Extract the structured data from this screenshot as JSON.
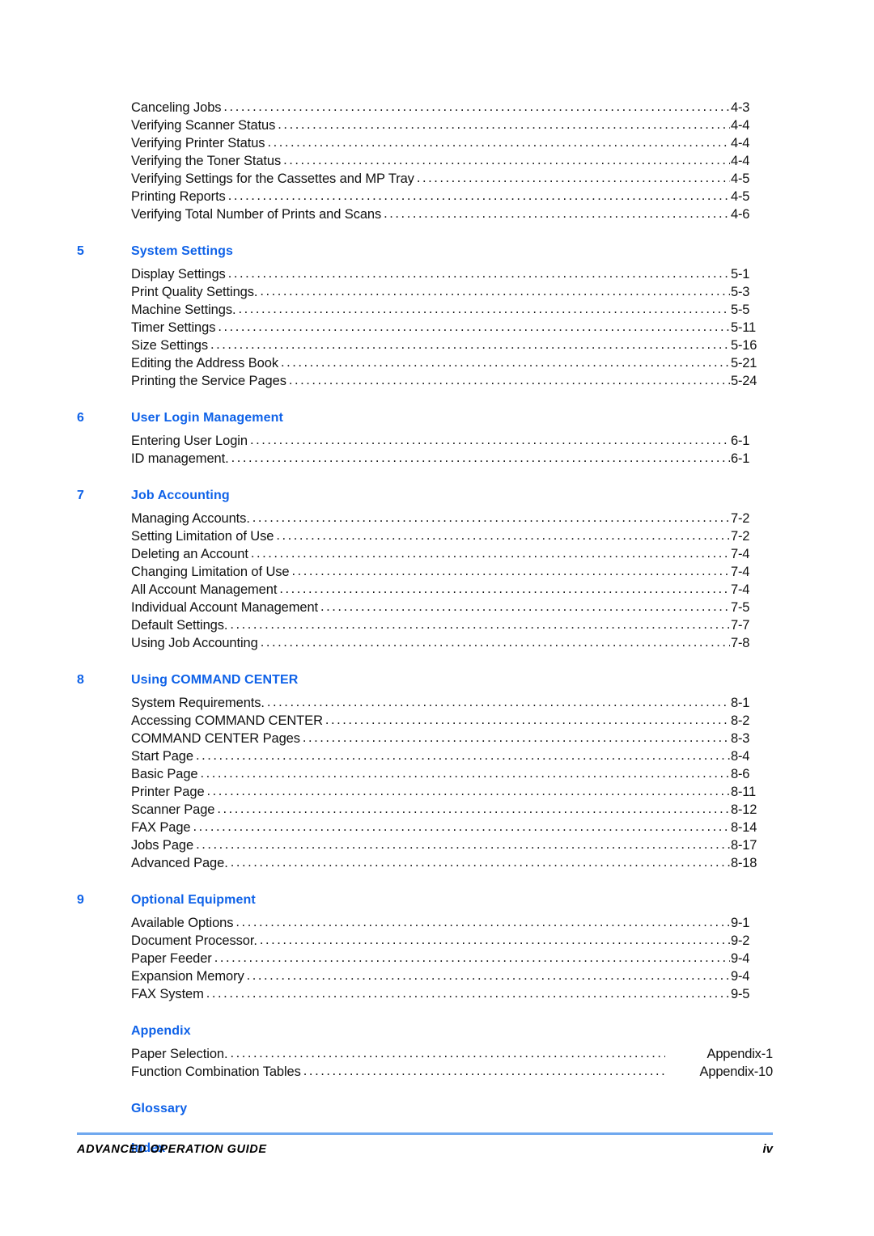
{
  "document": {
    "footer_title": "ADVANCED OPERATION GUIDE",
    "footer_page": "iv",
    "rule_color": "#6fa8ef",
    "heading_color": "#0f62e8",
    "leader_char": "."
  },
  "toc": {
    "blocks": [
      {
        "id": "continued-chapter-4",
        "number": "",
        "title": "",
        "has_heading": false,
        "spaced": false,
        "entries": [
          {
            "label": "Canceling Jobs",
            "page": "4-3",
            "wide": false
          },
          {
            "label": "Verifying Scanner Status",
            "page": "4-4",
            "wide": false
          },
          {
            "label": "Verifying Printer Status",
            "page": "4-4",
            "wide": false
          },
          {
            "label": "Verifying the Toner Status",
            "page": "4-4",
            "wide": false
          },
          {
            "label": "Verifying Settings for the Cassettes and MP Tray",
            "page": "4-5",
            "wide": false
          },
          {
            "label": "Printing Reports",
            "page": "4-5",
            "wide": false
          },
          {
            "label": "Verifying Total Number of Prints and Scans",
            "page": "4-6",
            "wide": false
          }
        ]
      },
      {
        "id": "chapter-5",
        "number": "5",
        "title": "System Settings",
        "has_heading": true,
        "spaced": true,
        "entries": [
          {
            "label": "Display Settings",
            "page": "5-1",
            "wide": false
          },
          {
            "label": "Print Quality Settings.",
            "page": "5-3",
            "wide": false
          },
          {
            "label": "Machine Settings.",
            "page": "5-5",
            "wide": false
          },
          {
            "label": "Timer Settings",
            "page": "5-11",
            "wide": false
          },
          {
            "label": "Size Settings",
            "page": "5-16",
            "wide": false
          },
          {
            "label": "Editing the Address Book",
            "page": "5-21",
            "wide": false
          },
          {
            "label": "Printing the Service Pages",
            "page": "5-24",
            "wide": false
          }
        ]
      },
      {
        "id": "chapter-6",
        "number": "6",
        "title": "User Login Management",
        "has_heading": true,
        "spaced": true,
        "entries": [
          {
            "label": "Entering User Login",
            "page": "6-1",
            "wide": false
          },
          {
            "label": "ID management.",
            "page": "6-1",
            "wide": false
          }
        ]
      },
      {
        "id": "chapter-7",
        "number": "7",
        "title": "Job Accounting",
        "has_heading": true,
        "spaced": true,
        "entries": [
          {
            "label": "Managing Accounts.",
            "page": "7-2",
            "wide": false
          },
          {
            "label": "Setting Limitation of Use",
            "page": "7-2",
            "wide": false
          },
          {
            "label": "Deleting an Account",
            "page": "7-4",
            "wide": false
          },
          {
            "label": "Changing Limitation of Use",
            "page": "7-4",
            "wide": false
          },
          {
            "label": "All Account Management",
            "page": "7-4",
            "wide": false
          },
          {
            "label": "Individual Account Management",
            "page": "7-5",
            "wide": false
          },
          {
            "label": "Default Settings.",
            "page": "7-7",
            "wide": false
          },
          {
            "label": "Using Job Accounting",
            "page": "7-8",
            "wide": false
          }
        ]
      },
      {
        "id": "chapter-8",
        "number": "8",
        "title": "Using COMMAND CENTER",
        "has_heading": true,
        "spaced": true,
        "entries": [
          {
            "label": "System Requirements.",
            "page": "8-1",
            "wide": false
          },
          {
            "label": "Accessing COMMAND CENTER",
            "page": "8-2",
            "wide": false
          },
          {
            "label": "COMMAND CENTER Pages",
            "page": "8-3",
            "wide": false
          },
          {
            "label": "Start Page",
            "page": "8-4",
            "wide": false
          },
          {
            "label": "Basic Page",
            "page": "8-6",
            "wide": false
          },
          {
            "label": "Printer Page",
            "page": "8-11",
            "wide": false
          },
          {
            "label": "Scanner Page",
            "page": "8-12",
            "wide": false
          },
          {
            "label": "FAX Page",
            "page": "8-14",
            "wide": false
          },
          {
            "label": "Jobs Page",
            "page": "8-17",
            "wide": false
          },
          {
            "label": "Advanced Page.",
            "page": "8-18",
            "wide": false
          }
        ]
      },
      {
        "id": "chapter-9",
        "number": "9",
        "title": "Optional Equipment",
        "has_heading": true,
        "spaced": true,
        "entries": [
          {
            "label": "Available Options",
            "page": "9-1",
            "wide": false
          },
          {
            "label": "Document Processor.",
            "page": "9-2",
            "wide": false
          },
          {
            "label": "Paper Feeder",
            "page": "9-4",
            "wide": false
          },
          {
            "label": "Expansion Memory",
            "page": "9-4",
            "wide": false
          },
          {
            "label": "FAX System",
            "page": "9-5",
            "wide": false
          }
        ]
      },
      {
        "id": "appendix",
        "number": "",
        "title": "Appendix",
        "has_heading": true,
        "spaced": true,
        "entries": [
          {
            "label": "Paper Selection.",
            "page": "Appendix-1",
            "wide": true
          },
          {
            "label": "Function Combination Tables",
            "page": "Appendix-10",
            "wide": true
          }
        ]
      },
      {
        "id": "glossary",
        "number": "",
        "title": "Glossary",
        "has_heading": true,
        "spaced": true,
        "entries": []
      },
      {
        "id": "index",
        "number": "",
        "title": "Index",
        "has_heading": true,
        "spaced": true,
        "entries": []
      }
    ]
  }
}
